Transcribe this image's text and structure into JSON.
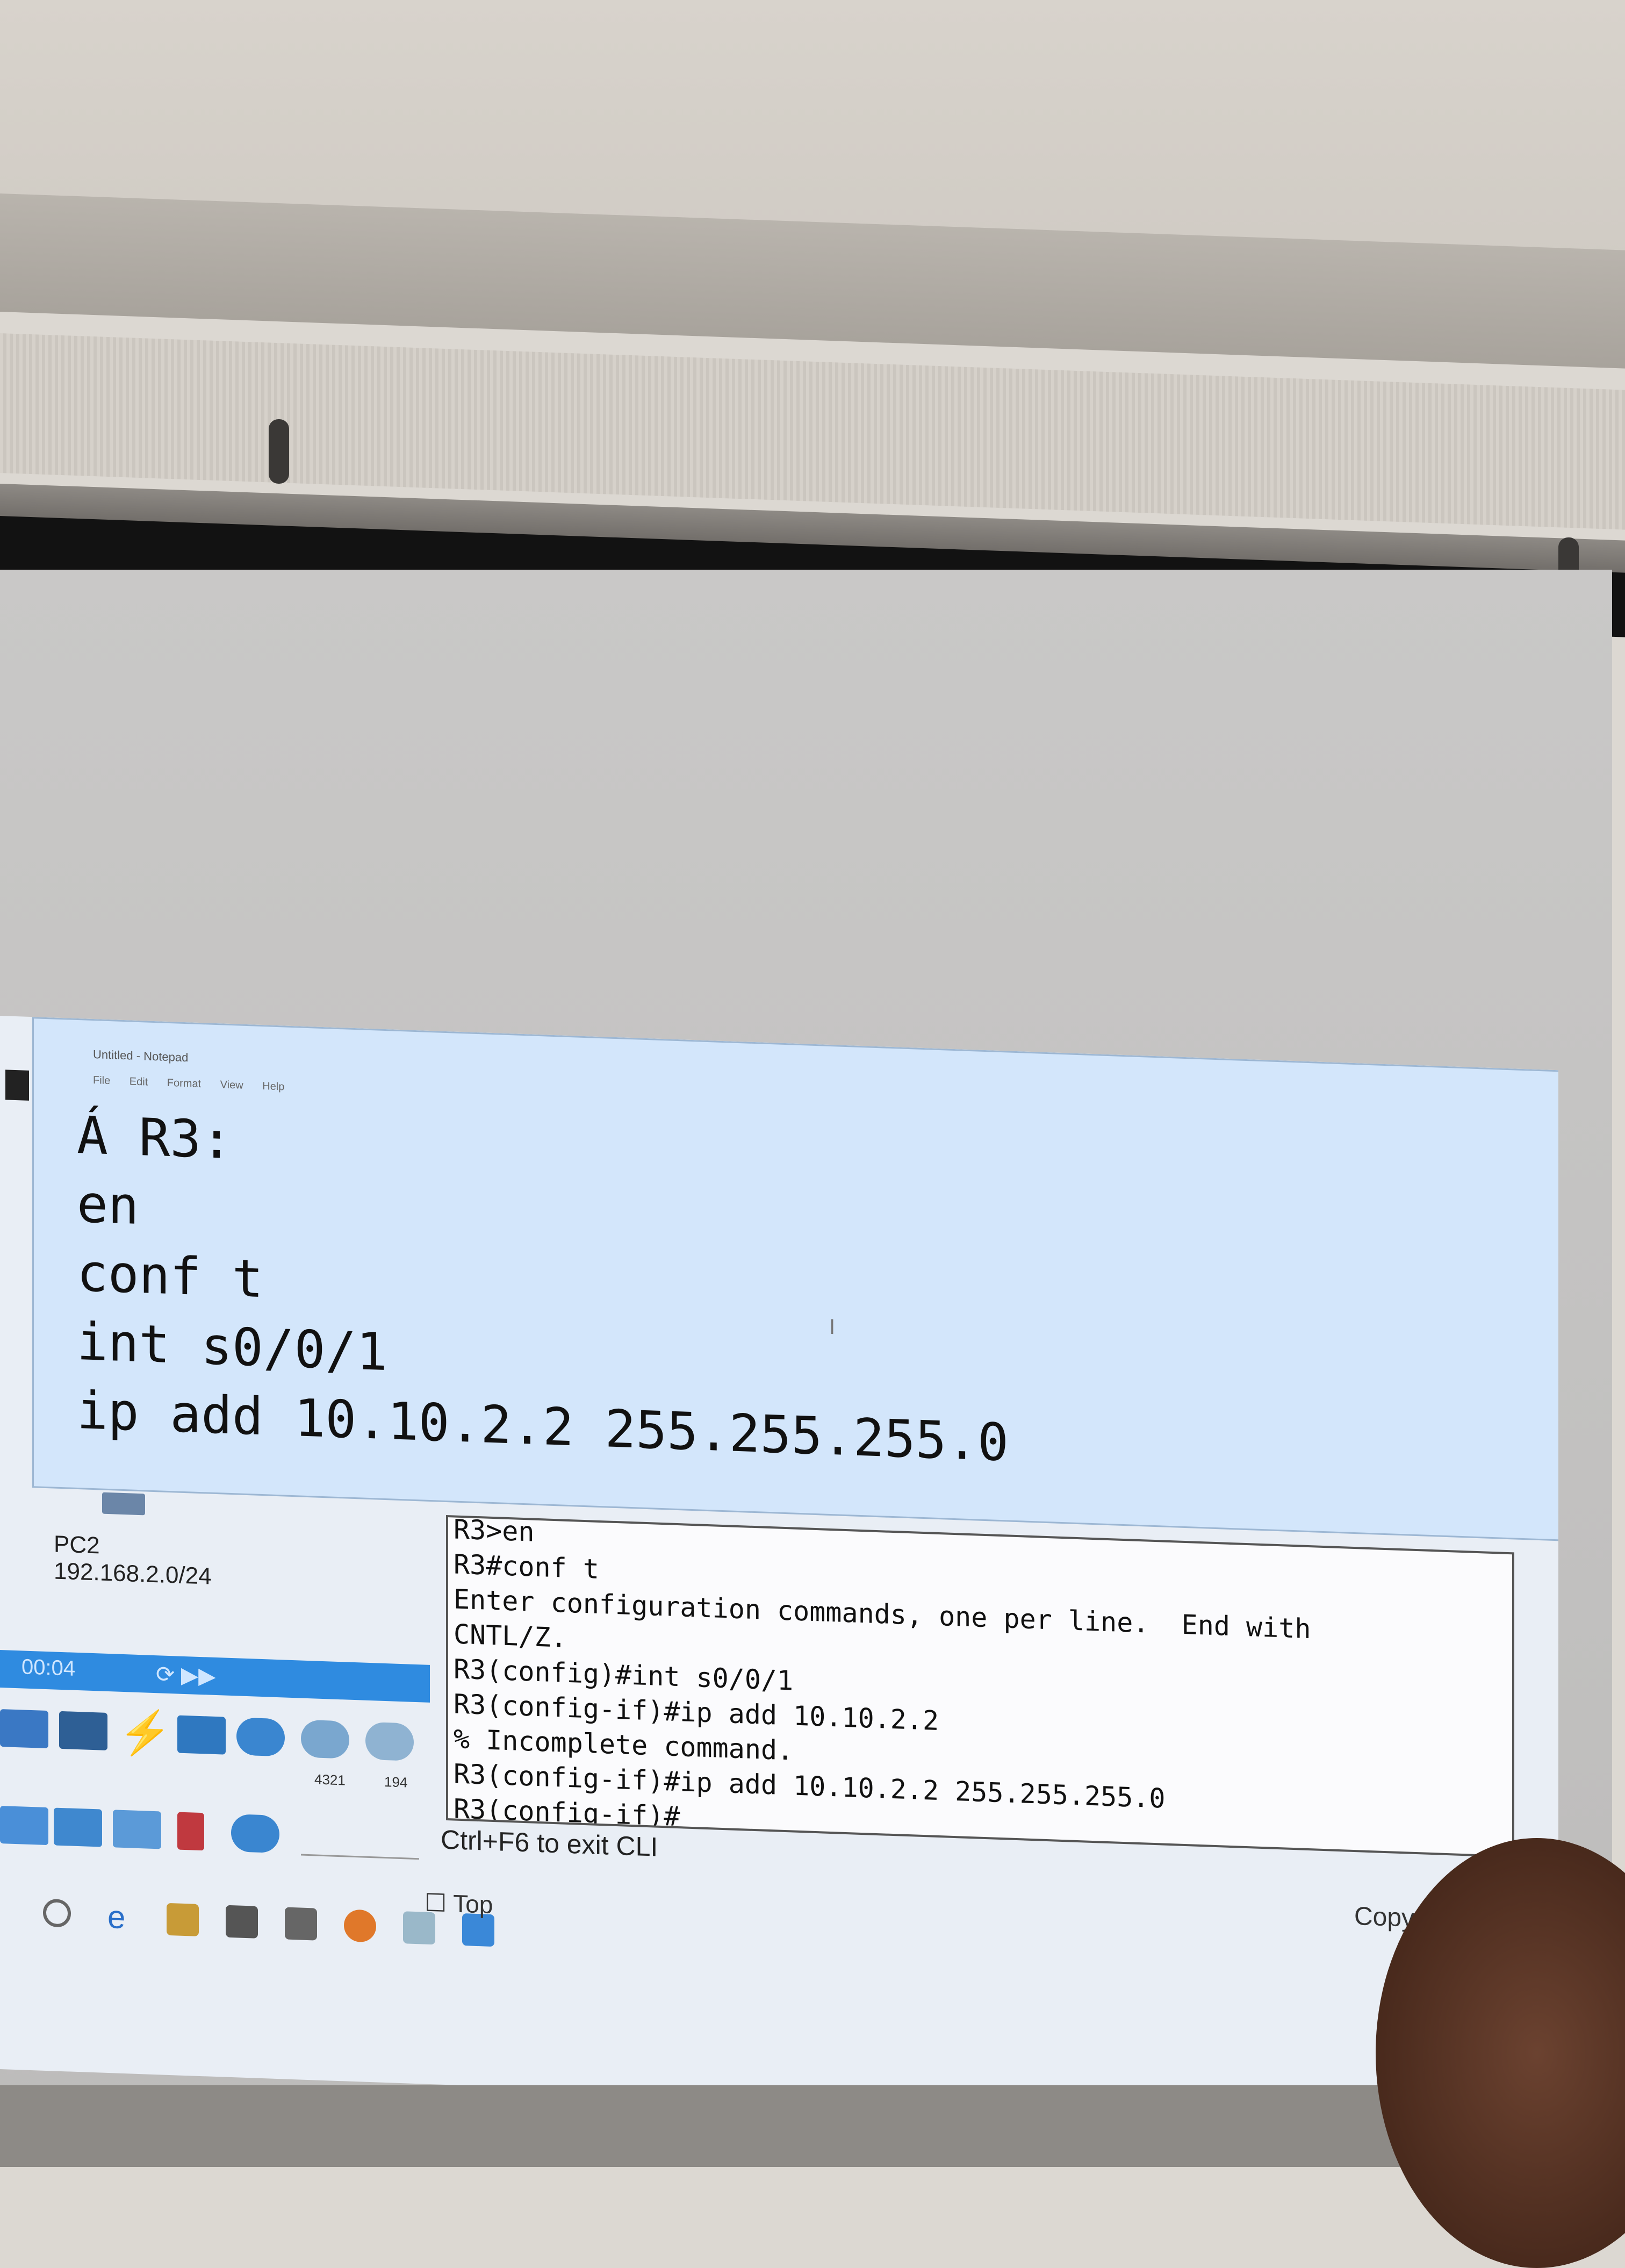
{
  "notepad": {
    "title": "Untitled - Notepad",
    "menu": "File Edit Format View Help",
    "lines": [
      "Á R3:",
      "en",
      "conf t",
      "int s0/0/1",
      "ip add 10.10.2.2 255.255.255.0"
    ],
    "cursor_mark": "I"
  },
  "cli": {
    "lines": [
      "R3>en",
      "R3#conf t",
      "Enter configuration commands, one per line.  End with",
      "CNTL/Z.",
      "R3(config)#int s0/0/1",
      "R3(config-if)#ip add 10.10.2.2",
      "% Incomplete command.",
      "R3(config-if)#ip add 10.10.2.2 255.255.255.0",
      "R3(config-if)#"
    ],
    "exit_hint": "Ctrl+F6 to exit CLI"
  },
  "topology": {
    "pc_label": "PC2",
    "subnet": "192.168.2.0/24"
  },
  "sim": {
    "time": "00:04",
    "device_labels": [
      "4321",
      "194"
    ]
  },
  "buttons": {
    "top_checkbox": "Top",
    "copy": "Copy"
  },
  "colors": {
    "notepad_bg": "#d3e6fb",
    "timebar": "#2f8be0",
    "cli_bg": "#fbfbfd"
  }
}
